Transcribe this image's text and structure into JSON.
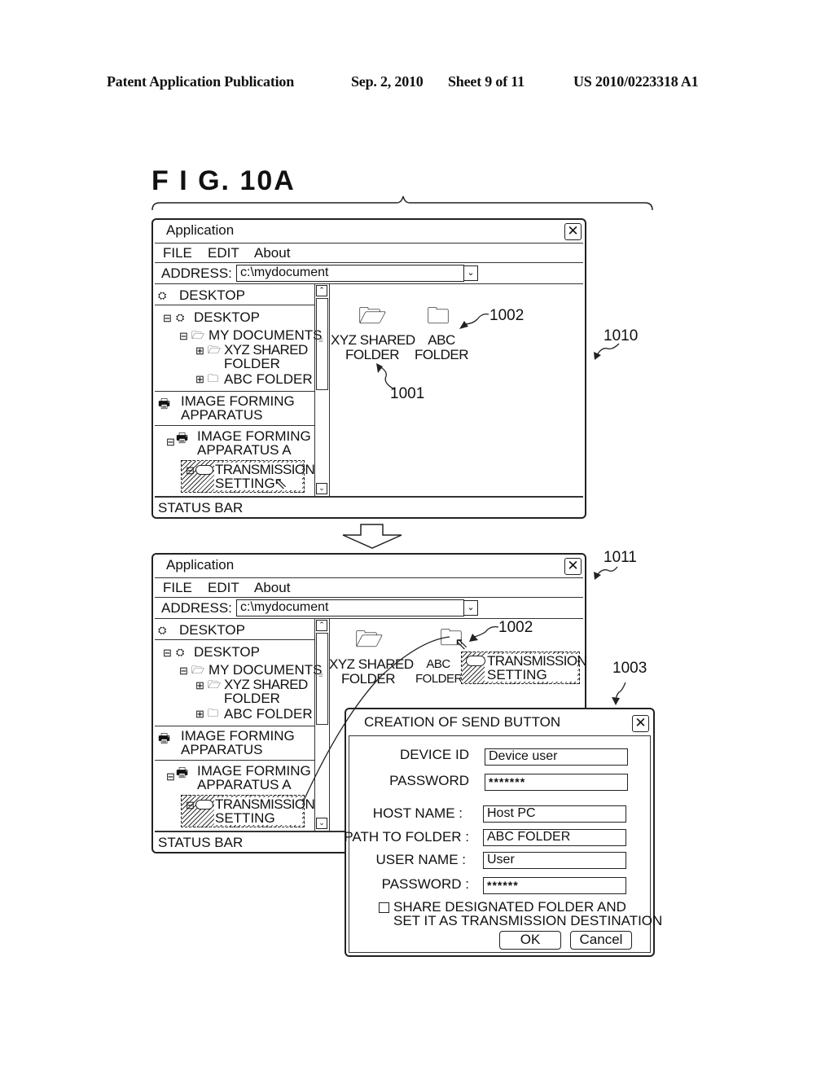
{
  "header": {
    "publication": "Patent Application Publication",
    "date": "Sep. 2, 2010",
    "sheet": "Sheet 9 of 11",
    "number": "US 2010/0223318 A1"
  },
  "figure": {
    "title": "F I G. 10A"
  },
  "window1": {
    "ref": "1010",
    "title": "Application",
    "close": "✕",
    "menu": [
      "FILE",
      "EDIT",
      "About"
    ],
    "address_label": "ADDRESS:",
    "address_value": "c:\\mydocument",
    "dropdown": "⌄",
    "sidebar": {
      "root": "DESKTOP",
      "tree": {
        "desktop": "DESKTOP",
        "my_documents": "MY DOCUMENTS",
        "xyz_line1": "XYZ SHARED",
        "xyz_line2": "FOLDER",
        "abc": "ABC FOLDER"
      },
      "device_section": {
        "line1": "IMAGE FORMING",
        "line2": "APPARATUS"
      },
      "device_a": {
        "line1": "IMAGE FORMING",
        "line2": "APPARATUS A"
      },
      "transmission": {
        "line1": "TRANSMISSION",
        "line2": "SETTING"
      }
    },
    "scroll_up": "⌃",
    "scroll_down": "⌄",
    "scroll_grip": "≡",
    "folders": [
      {
        "line1": "XYZ SHARED",
        "line2": "FOLDER",
        "ref": "1001"
      },
      {
        "line1": "ABC",
        "line2": "FOLDER",
        "ref": "1002"
      }
    ],
    "status_bar": "STATUS BAR"
  },
  "window2": {
    "ref": "1011",
    "title": "Application",
    "close": "✕",
    "menu": [
      "FILE",
      "EDIT",
      "About"
    ],
    "address_label": "ADDRESS:",
    "address_value": "c:\\mydocument",
    "dropdown": "⌄",
    "sidebar": {
      "root": "DESKTOP",
      "tree": {
        "desktop": "DESKTOP",
        "my_documents": "MY DOCUMENTS",
        "xyz_line1": "XYZ SHARED",
        "xyz_line2": "FOLDER",
        "abc": "ABC FOLDER"
      },
      "device_section": {
        "line1": "IMAGE FORMING",
        "line2": "APPARATUS"
      },
      "device_a": {
        "line1": "IMAGE FORMING",
        "line2": "APPARATUS A"
      },
      "transmission": {
        "line1": "TRANSMISSION",
        "line2": "SETTING"
      }
    },
    "scroll_up": "⌃",
    "scroll_down": "⌄",
    "scroll_grip": "≡",
    "folders": [
      {
        "line1": "XYZ SHARED",
        "line2": "FOLDER"
      },
      {
        "line1": "ABC",
        "line2": "FOLDER",
        "ref": "1002"
      }
    ],
    "dragged_item": {
      "line1": "TRANSMISSION",
      "line2": "SETTING"
    },
    "status_bar": "STATUS BAR"
  },
  "dialog": {
    "ref": "1003",
    "title": "CREATION OF SEND BUTTON",
    "close": "✕",
    "fields": [
      {
        "label": "DEVICE ID",
        "value": "Device user"
      },
      {
        "label": "PASSWORD",
        "value": "*******"
      },
      {
        "label": "HOST NAME :",
        "value": "Host PC"
      },
      {
        "label": "PATH TO FOLDER :",
        "value": "ABC FOLDER"
      },
      {
        "label": "USER NAME :",
        "value": "User"
      },
      {
        "label": "PASSWORD :",
        "value": "******"
      }
    ],
    "checkbox": {
      "checked": false,
      "line1": "SHARE DESIGNATED FOLDER AND",
      "line2": "SET IT AS TRANSMISSION DESTINATION"
    },
    "ok": "OK",
    "cancel": "Cancel"
  }
}
